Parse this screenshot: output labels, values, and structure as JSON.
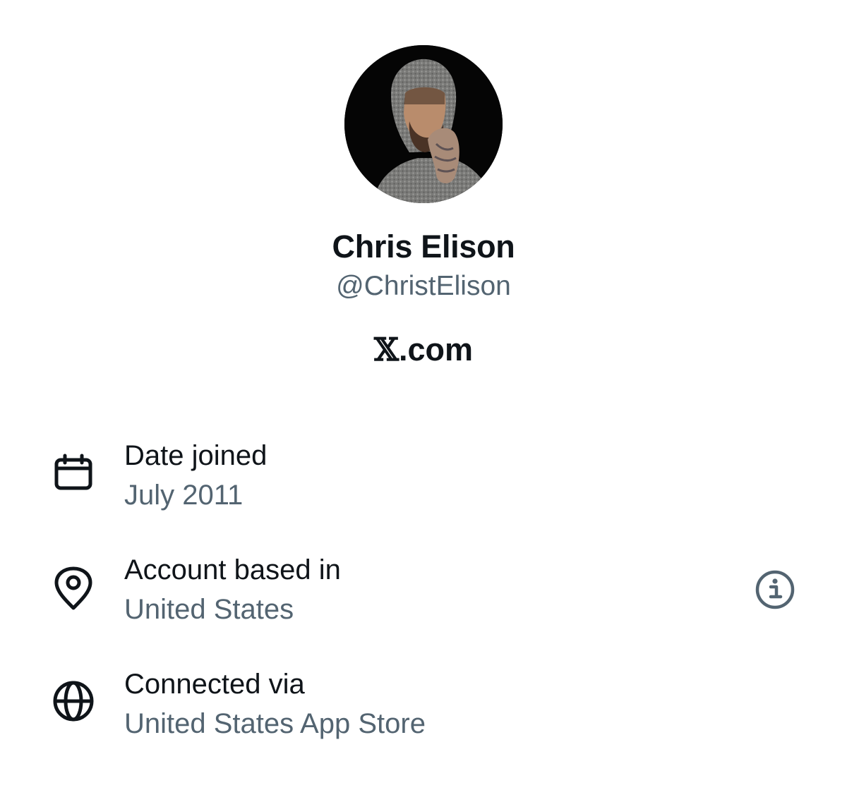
{
  "profile": {
    "display_name": "Chris Elison",
    "handle": "@ChristElison",
    "site_prefix": "𝕏",
    "site_suffix": ".com"
  },
  "details": [
    {
      "icon": "calendar-icon",
      "label": "Date joined",
      "value": "July 2011"
    },
    {
      "icon": "location-pin-icon",
      "label": "Account based in",
      "value": "United States"
    },
    {
      "icon": "globe-icon",
      "label": "Connected via",
      "value": "United States App Store"
    }
  ],
  "colors": {
    "primary_text": "#0f1419",
    "secondary_text": "#536471",
    "icon_stroke": "#0f1419",
    "info_icon": "#536471",
    "background": "#ffffff"
  }
}
